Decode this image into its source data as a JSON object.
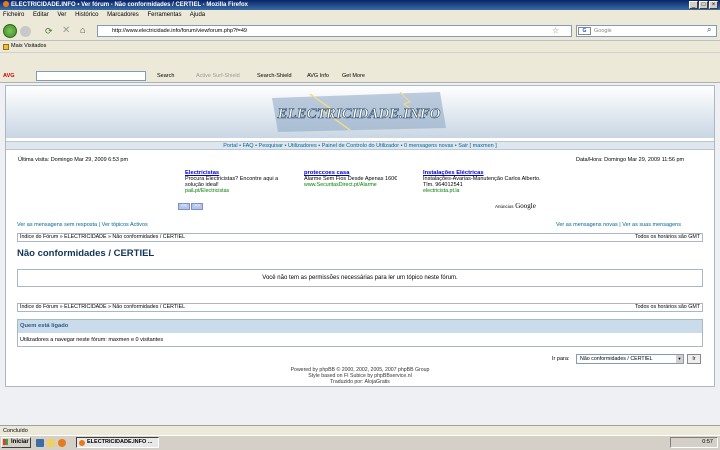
{
  "window": {
    "title": "ELECTRICIDADE.INFO • Ver fórum - Não conformidades / CERTIEL - Mozilla Firefox"
  },
  "menu": [
    "Ficheiro",
    "Editar",
    "Ver",
    "Histórico",
    "Marcadores",
    "Ferramentas",
    "Ajuda"
  ],
  "nav": {
    "url": "http://www.electricidade.info/forum/viewforum.php?f=49",
    "search_placeholder": "Google"
  },
  "bookmarks": {
    "item": "Mais Visitados"
  },
  "avg": {
    "logo": "AVG",
    "search": "Search",
    "active_surf": "Active Surf-Shield",
    "search_shield": "Search-Shield",
    "avg_info": "AVG Info",
    "get_more": "Get More"
  },
  "site": {
    "logo": "ELECTRICIDADE.INFO",
    "topnav": "Portal  •  FAQ  •  Pesquisar  •  Utilizadores  •  Painel de Controlo do Utilizador  •  0 mensagens novas  •  Sair [ maxmen ]",
    "last_visit": "Última visita: Domingo Mar 29, 2009 6:53 pm",
    "datetime": "Data/Hora: Domingo Mar 29, 2009 11:56 pm",
    "ads": [
      {
        "title": "Electricistas",
        "text": "Procura Electricistas? Encontre aqui a solução ideal!",
        "url": "paiLpt/Electricistas"
      },
      {
        "title": "proteccoes casa",
        "text": "Alarme Sem Fios Desde Apenas 160€",
        "url": "www.SecuritasDirect.pt/Alarme"
      },
      {
        "title": "Instalações Eléctricas",
        "text": "Instalações-Avarias-Manutenção Carlos Alberto. Tlm. 964012541",
        "url": "electricista.pt.la"
      }
    ],
    "ads_label": "Anúncios",
    "ads_brand": "Google",
    "links_left": "Ver as mensagens sem resposta | Ver tópicos Activos",
    "links_right": "Ver as mensagens novas | Ver as suas mensagens",
    "breadcrumb": "Índice do Fórum » ELECTRICIDADE » Não conformidades / CERTIEL",
    "timezone": "Todos os horários são GMT",
    "forum_title": "Não conformidades / CERTIEL",
    "message": "Você não tem as permissões necessárias para ler um tópico neste fórum.",
    "who_title": "Quem está ligado",
    "who_text": "Utilizadores a navegar neste fórum: maxmen e 0 visitantes",
    "jump_label": "Ir para:",
    "jump_value": "Não conformidades / CERTIEL",
    "jump_button": "Ir",
    "footer1": "Powered by phpBB © 2000, 2002, 2005, 2007 phpBB Group",
    "footer2": "Style based on FI Subice by phpBBservice.nl",
    "footer3": "Traduzido por: AlojaGratis"
  },
  "status": {
    "text": "Concluído"
  },
  "taskbar": {
    "start": "Iniciar",
    "item": "ELECTRICIDADE.INFO ...",
    "clock": "0:57"
  }
}
